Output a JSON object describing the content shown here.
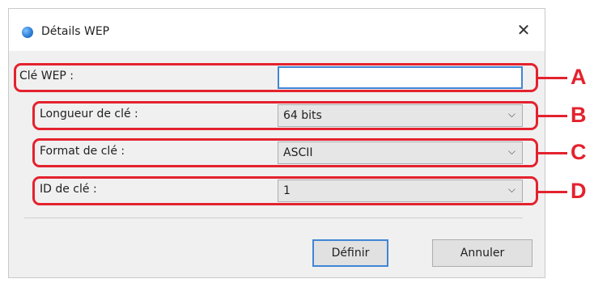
{
  "dialog": {
    "title": "Détails WEP",
    "close_glyph": "✕"
  },
  "fields": {
    "wep_key": {
      "label": "Clé WEP :",
      "value": ""
    },
    "key_length": {
      "label": "Longueur de clé :",
      "value": "64 bits"
    },
    "key_format": {
      "label": "Format de clé :",
      "value": "ASCII"
    },
    "key_id": {
      "label": "ID de clé :",
      "value": "1"
    }
  },
  "chevron_glyph": "⌵",
  "buttons": {
    "define": "Définir",
    "cancel": "Annuler"
  },
  "markers": {
    "a": "A",
    "b": "B",
    "c": "C",
    "d": "D"
  },
  "colors": {
    "annotation_red": "#e4222e",
    "focus_blue": "#3f86d6"
  }
}
